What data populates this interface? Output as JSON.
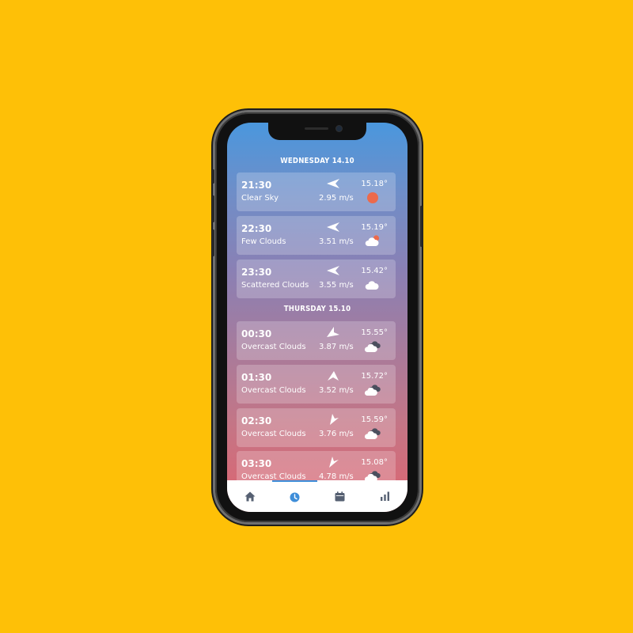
{
  "colors": {
    "background": "#FEC007",
    "gradient_top": "#4a97dd",
    "gradient_bottom": "#de6470",
    "active_tab": "#3f8ed9",
    "inactive_tab": "#566072",
    "sun": "#ec6a4c"
  },
  "days": [
    {
      "label": "WEDNESDAY 14.10"
    },
    {
      "label": "THURSDAY 15.10"
    }
  ],
  "forecast": [
    {
      "time": "21:30",
      "desc": "Clear Sky",
      "speed": "2.95 m/s",
      "temp": "15.18°",
      "icon": "sun-icon",
      "wind_dir": "wind-arrow-west-icon"
    },
    {
      "time": "22:30",
      "desc": "Few Clouds",
      "speed": "3.51 m/s",
      "temp": "15.19°",
      "icon": "cloud-sun-icon",
      "wind_dir": "wind-arrow-west-icon"
    },
    {
      "time": "23:30",
      "desc": "Scattered Clouds",
      "speed": "3.55 m/s",
      "temp": "15.42°",
      "icon": "cloud-icon",
      "wind_dir": "wind-arrow-west-icon"
    },
    {
      "time": "00:30",
      "desc": "Overcast Clouds",
      "speed": "3.87 m/s",
      "temp": "15.55°",
      "icon": "overcast-clouds-icon",
      "wind_dir": "wind-arrow-southwest-icon"
    },
    {
      "time": "01:30",
      "desc": "Overcast Clouds",
      "speed": "3.52 m/s",
      "temp": "15.72°",
      "icon": "overcast-clouds-icon",
      "wind_dir": "wind-arrow-south-icon"
    },
    {
      "time": "02:30",
      "desc": "Overcast Clouds",
      "speed": "3.76 m/s",
      "temp": "15.59°",
      "icon": "overcast-clouds-icon",
      "wind_dir": "wind-arrow-southeast-icon"
    },
    {
      "time": "03:30",
      "desc": "Overcast Clouds",
      "speed": "4.78 m/s",
      "temp": "15.08°",
      "icon": "overcast-clouds-icon",
      "wind_dir": "wind-arrow-south-icon"
    }
  ],
  "tabs": [
    {
      "name": "home-icon",
      "active": false
    },
    {
      "name": "clock-icon",
      "active": true
    },
    {
      "name": "calendar-icon",
      "active": false
    },
    {
      "name": "bar-chart-icon",
      "active": false
    }
  ]
}
